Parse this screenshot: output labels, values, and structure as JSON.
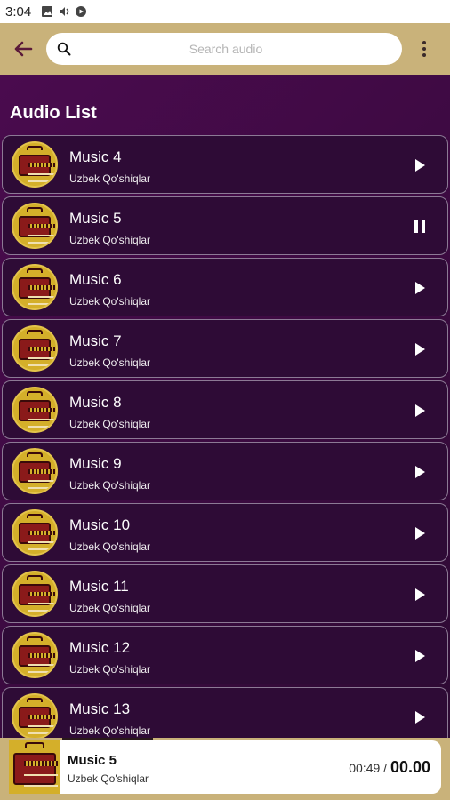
{
  "status_bar": {
    "time": "3:04"
  },
  "search": {
    "placeholder": "Search audio",
    "value": ""
  },
  "list_title": "Audio List",
  "colors": {
    "toolbar": "#c9b27a",
    "list_bg": "#3a0a3f",
    "item_bg": "#2e0b36",
    "accent": "#d4af2a"
  },
  "items": [
    {
      "title": "Music 4",
      "subtitle": "Uzbek Qo'shiqlar",
      "state": "play"
    },
    {
      "title": "Music 5",
      "subtitle": "Uzbek Qo'shiqlar",
      "state": "pause"
    },
    {
      "title": "Music 6",
      "subtitle": "Uzbek Qo'shiqlar",
      "state": "play"
    },
    {
      "title": "Music 7",
      "subtitle": "Uzbek Qo'shiqlar",
      "state": "play"
    },
    {
      "title": "Music 8",
      "subtitle": "Uzbek Qo'shiqlar",
      "state": "play"
    },
    {
      "title": "Music 9",
      "subtitle": "Uzbek Qo'shiqlar",
      "state": "play"
    },
    {
      "title": "Music 10",
      "subtitle": "Uzbek Qo'shiqlar",
      "state": "play"
    },
    {
      "title": "Music 11",
      "subtitle": "Uzbek Qo'shiqlar",
      "state": "play"
    },
    {
      "title": "Music 12",
      "subtitle": "Uzbek Qo'shiqlar",
      "state": "play"
    },
    {
      "title": "Music 13",
      "subtitle": "Uzbek Qo'shiqlar",
      "state": "play"
    }
  ],
  "player": {
    "title": "Music 5",
    "subtitle": "Uzbek Qo'shiqlar",
    "elapsed": "00:49",
    "separator": "/",
    "duration": "00.00",
    "progress": 0.47
  }
}
